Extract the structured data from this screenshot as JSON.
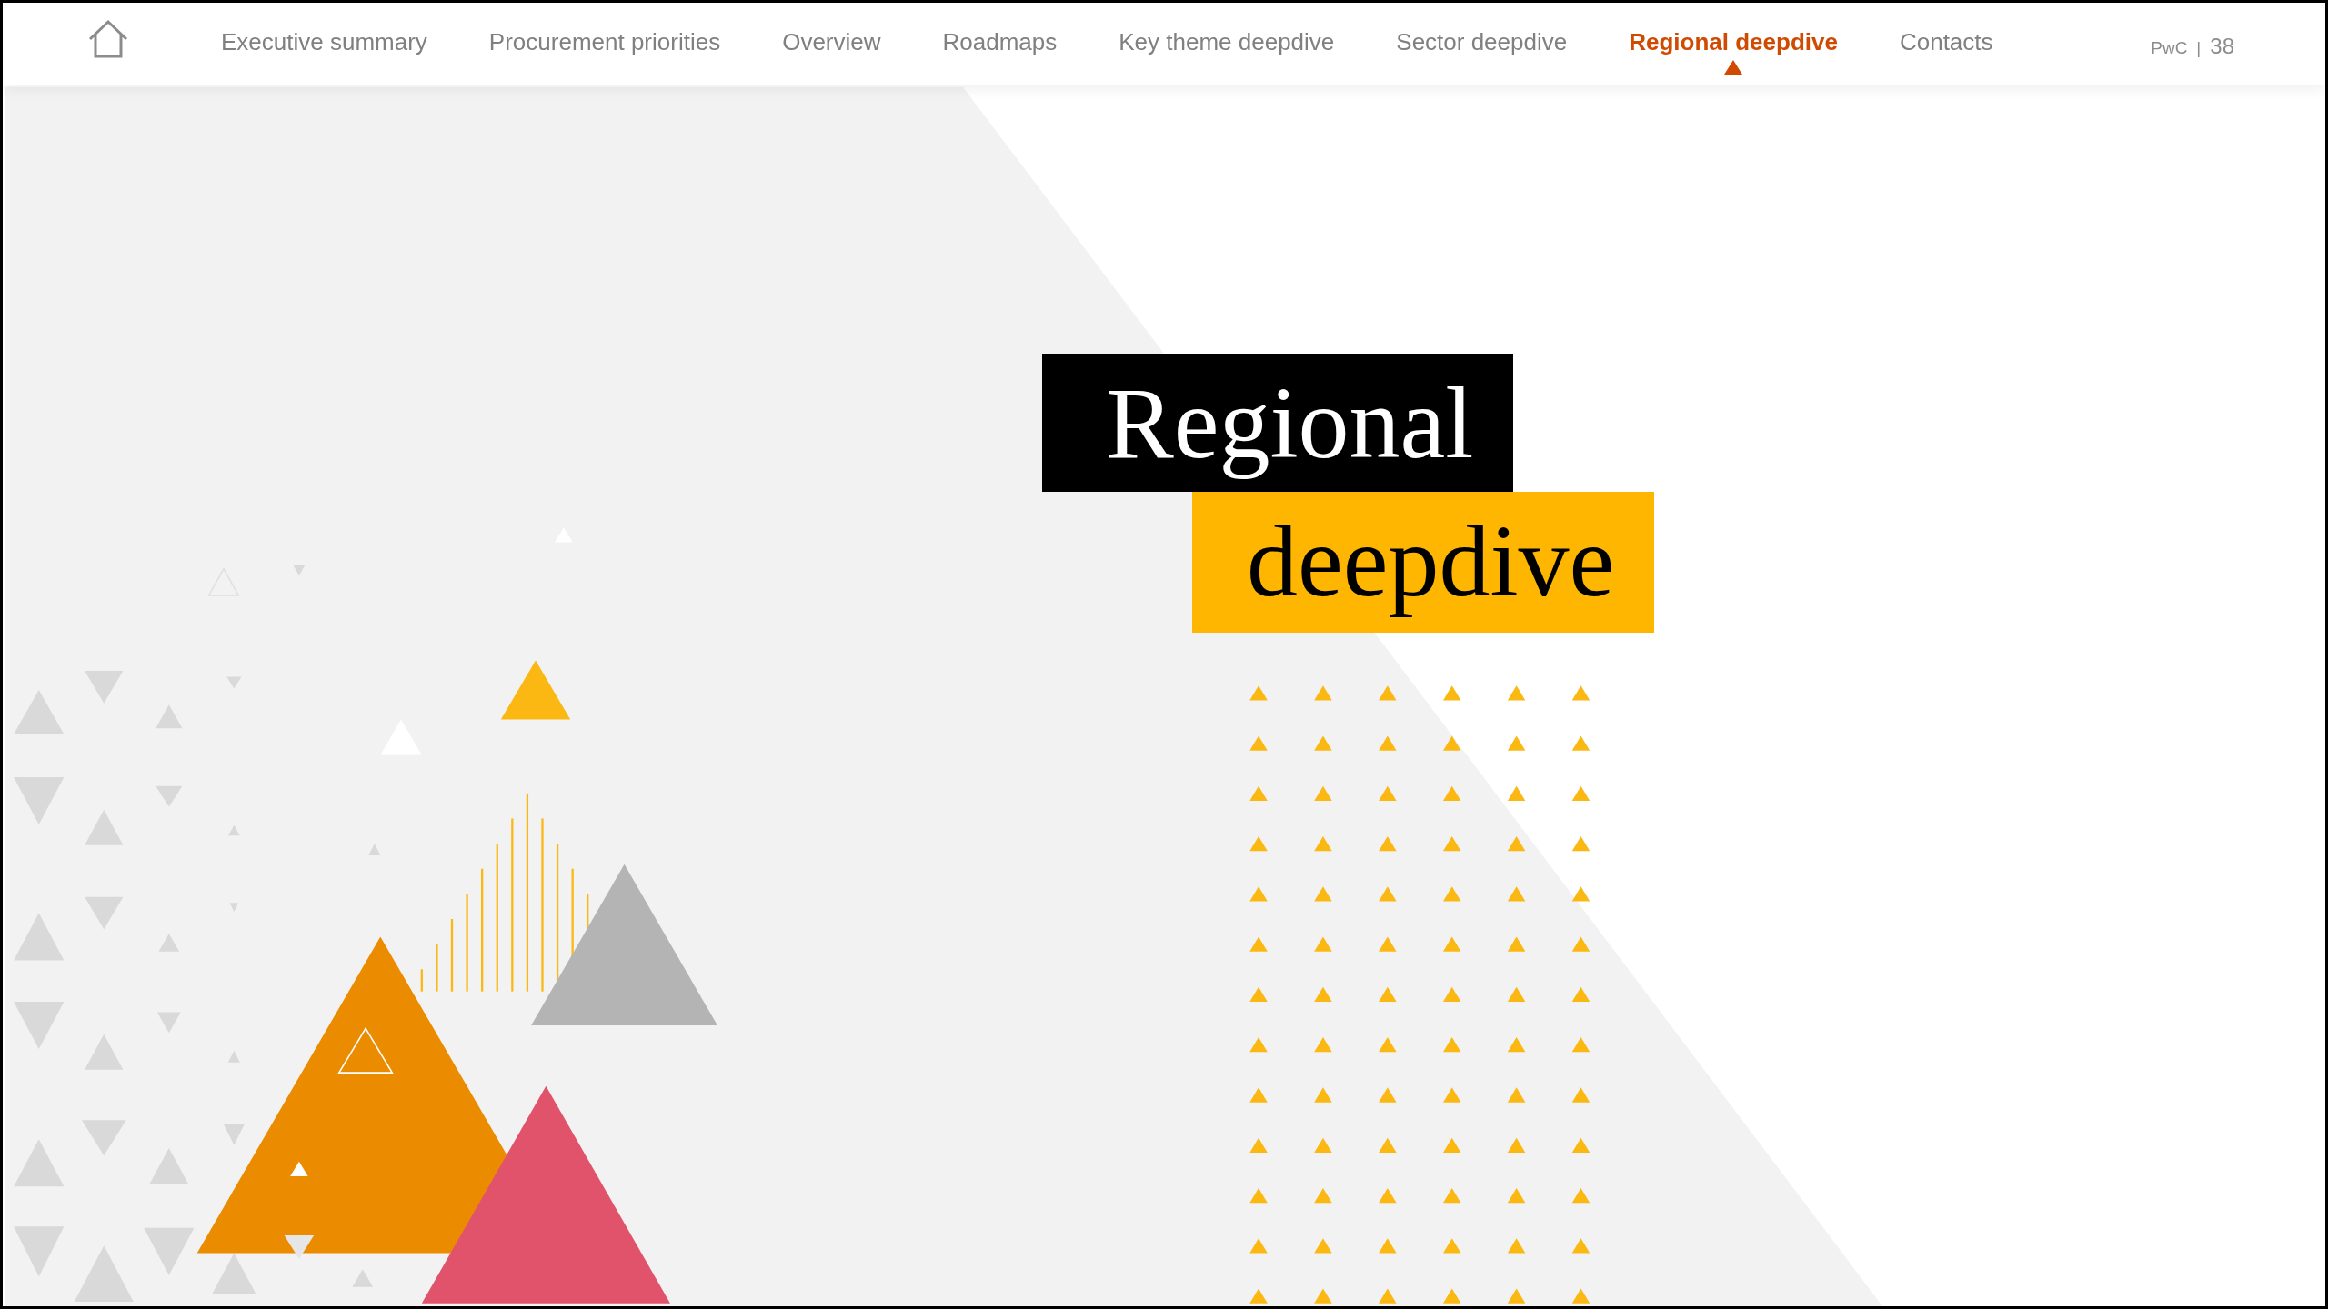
{
  "nav": {
    "items": [
      {
        "label": "Executive summary",
        "selected": false
      },
      {
        "label": "Procurement priorities",
        "selected": false
      },
      {
        "label": "Overview",
        "selected": false
      },
      {
        "label": "Roadmaps",
        "selected": false
      },
      {
        "label": "Key theme deepdive",
        "selected": false
      },
      {
        "label": "Sector deepdive",
        "selected": false
      },
      {
        "label": "Regional deepdive",
        "selected": true
      },
      {
        "label": "Contacts",
        "selected": false
      }
    ]
  },
  "footer_label": "PwC",
  "separator": "|",
  "page_number": "38",
  "title": {
    "lines": [
      "Regional",
      "deepdive"
    ]
  }
}
